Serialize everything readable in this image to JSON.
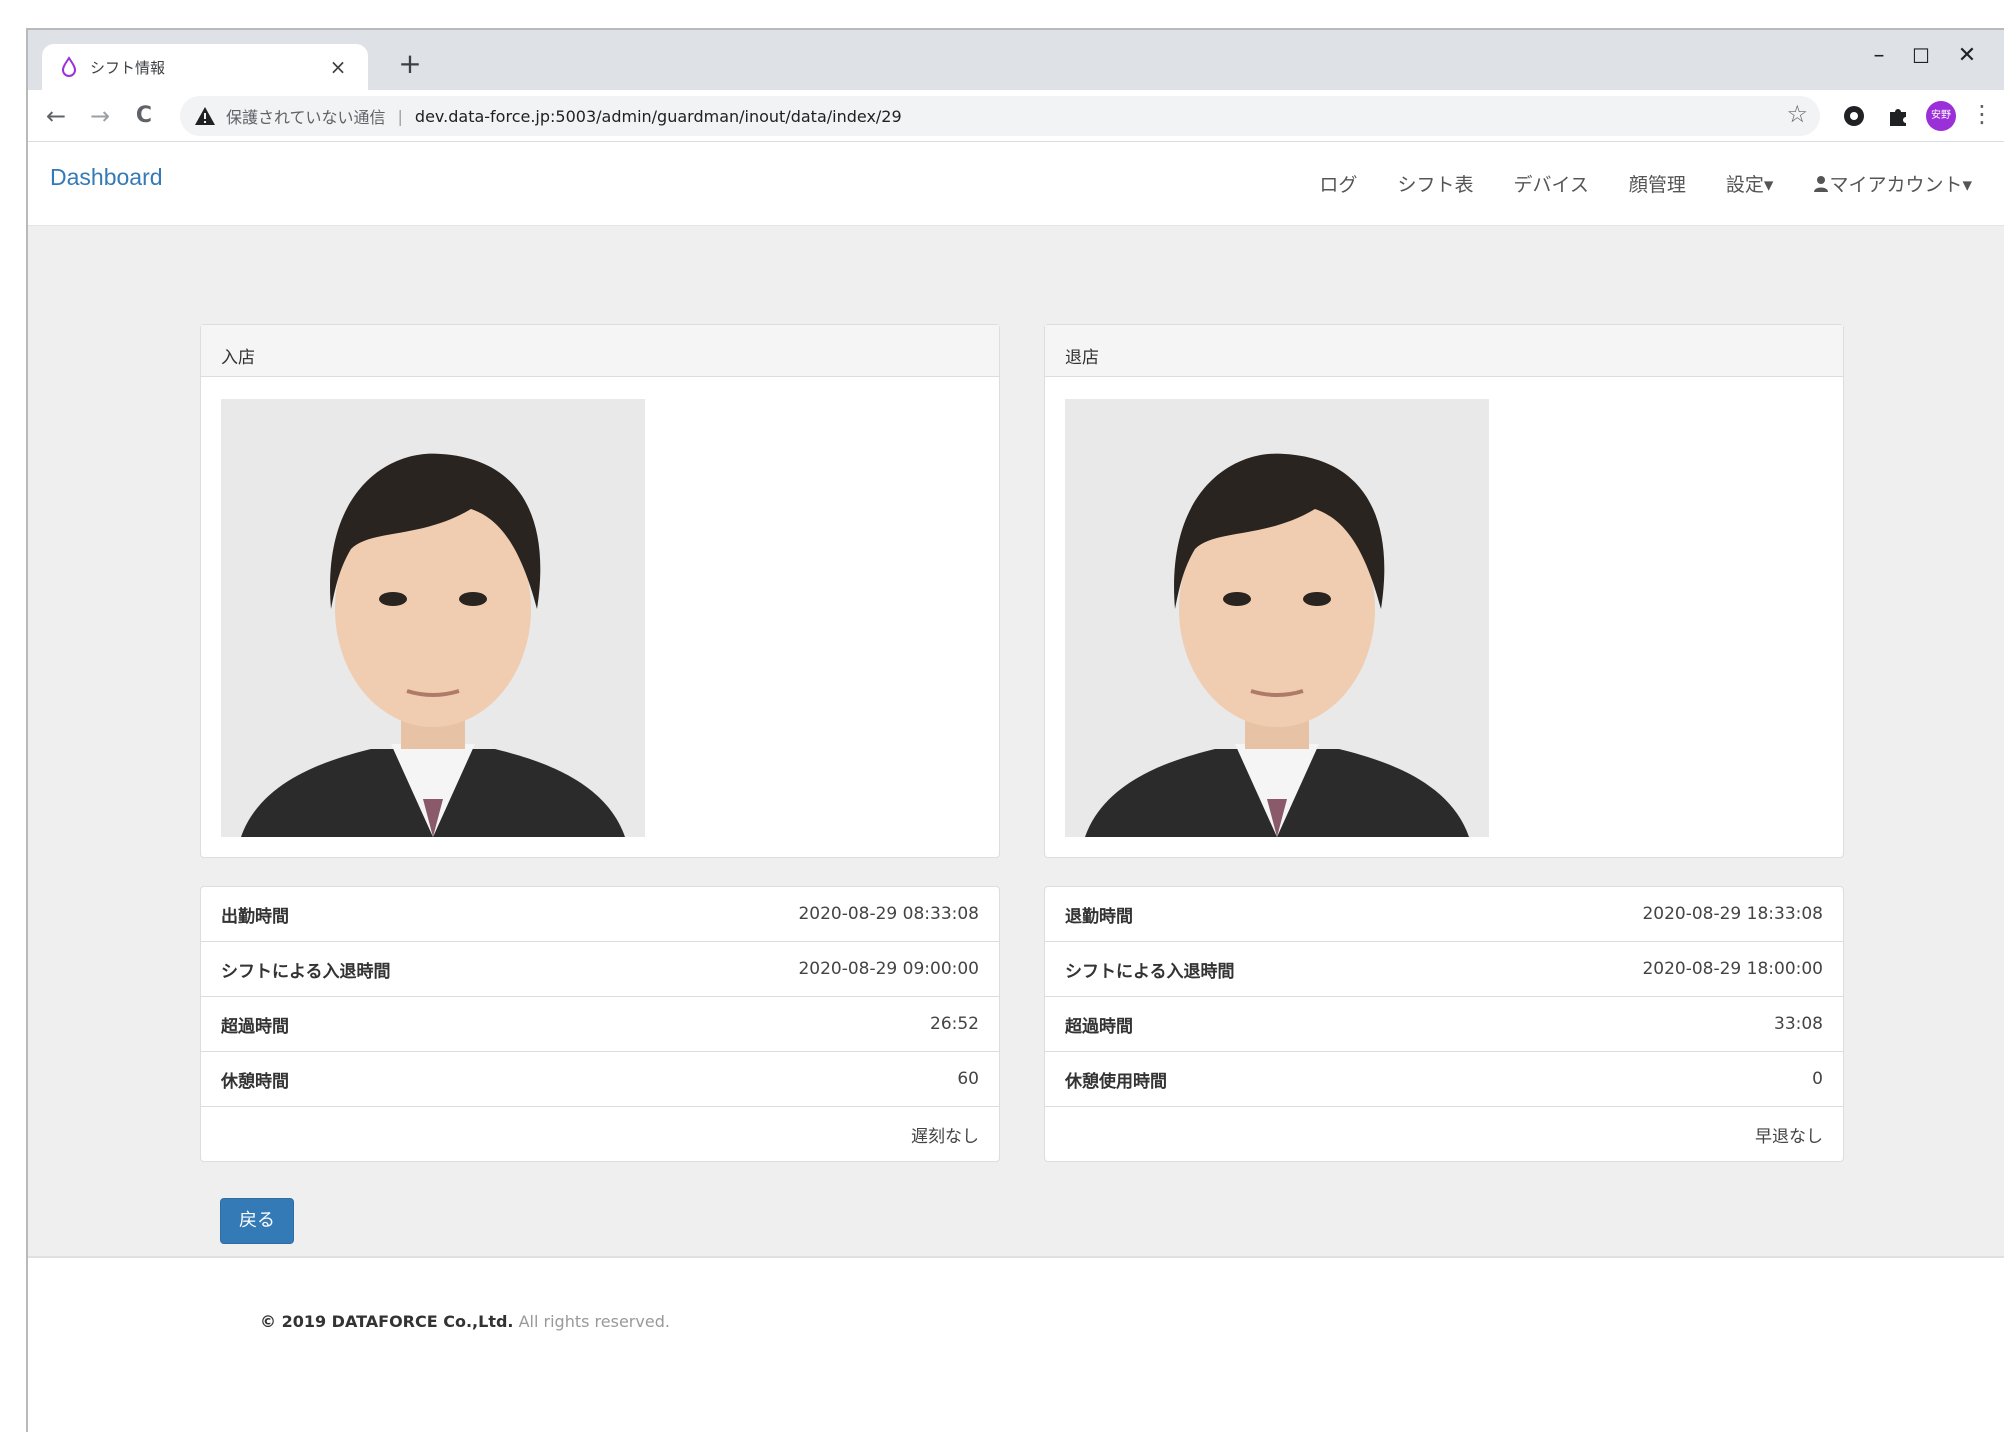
{
  "browser": {
    "tab_title": "シフト情報",
    "tab_close": "×",
    "new_tab": "+",
    "window_controls": {
      "minimize": "–",
      "maximize": "☐",
      "close": "✕"
    },
    "security_label": "保護されていない通信",
    "separator": "|",
    "url": "dev.data-force.jp:5003/admin/guardman/inout/data/index/29",
    "nav": {
      "back": "←",
      "forward": "→",
      "reload": "C"
    },
    "bookmark_star": "☆",
    "profile_badge": "安野",
    "menu_dots": "⋮",
    "accent_color": "#9b30d9"
  },
  "navbar": {
    "brand": "Dashboard",
    "items": [
      "ログ",
      "シフト表",
      "デバイス",
      "顔管理",
      "設定▾",
      "マイアカウント▾"
    ]
  },
  "checkin": {
    "title": "入店",
    "photo_icon": "person-photo",
    "rows": [
      {
        "label": "出勤時間",
        "value": "2020-08-29 08:33:08"
      },
      {
        "label": "シフトによる入退時間",
        "value": "2020-08-29 09:00:00"
      },
      {
        "label": "超過時間",
        "value": "26:52"
      },
      {
        "label": "休憩時間",
        "value": "60"
      }
    ],
    "status": "遅刻なし"
  },
  "checkout": {
    "title": "退店",
    "photo_icon": "person-photo",
    "rows": [
      {
        "label": "退勤時間",
        "value": "2020-08-29 18:33:08"
      },
      {
        "label": "シフトによる入退時間",
        "value": "2020-08-29 18:00:00"
      },
      {
        "label": "超過時間",
        "value": "33:08"
      },
      {
        "label": "休憩使用時間",
        "value": "0"
      }
    ],
    "status": "早退なし"
  },
  "actions": {
    "back_label": "戻る"
  },
  "footer": {
    "copyright": "© 2019 DATAFORCE Co.,Ltd.",
    "rights": "All rights reserved."
  },
  "colors": {
    "primary": "#337ab7",
    "brand_link": "#337ab7"
  }
}
